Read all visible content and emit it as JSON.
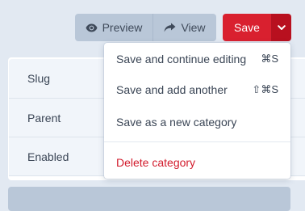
{
  "toolbar": {
    "preview_label": "Preview",
    "preview_icon": "eye-icon",
    "view_label": "View",
    "view_icon": "share-arrow-icon",
    "save_label": "Save",
    "caret_icon": "chevron-down-icon"
  },
  "form": {
    "rows": [
      {
        "label": "Slug"
      },
      {
        "label": "Parent"
      },
      {
        "label": "Enabled"
      }
    ]
  },
  "save_menu": {
    "items": [
      {
        "label": "Save and continue editing",
        "shortcut": "⌘S"
      },
      {
        "label": "Save and add another",
        "shortcut": "⇧⌘S"
      },
      {
        "label": "Save as a new category",
        "shortcut": ""
      },
      {
        "label": "Delete category",
        "shortcut": ""
      }
    ]
  },
  "colors": {
    "page_bg": "#e2e9f2",
    "save_red": "#d9202f",
    "caret_red": "#b8101f",
    "danger_text": "#d21b2c",
    "secondary_button": "#b9c7d8"
  }
}
